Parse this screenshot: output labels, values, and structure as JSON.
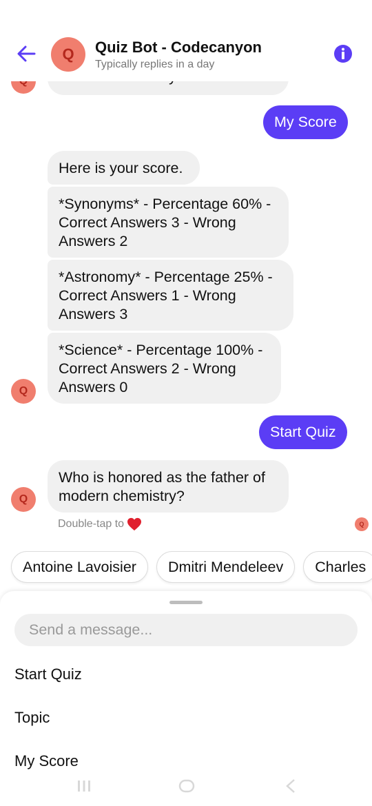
{
  "header": {
    "avatar_letter": "Q",
    "title": "Quiz Bot - Codecanyon",
    "subtitle": "Typically replies in a day"
  },
  "messages": {
    "top_partial": "modern chemistry?",
    "user_score": "My Score",
    "bot_intro": "Here is your score.",
    "score_synonyms": "*Synonyms* - Percentage 60% - Correct Answers 3 - Wrong Answers 2",
    "score_astronomy": "*Astronomy* - Percentage 25% - Correct Answers 1 - Wrong Answers 3",
    "score_science": "*Science* - Percentage 100% - Correct Answers 2 - Wrong Answers 0",
    "user_start": "Start Quiz",
    "bot_question": "Who is honored as the father of modern chemistry?",
    "avatar_letter": "Q"
  },
  "hint": {
    "text": "Double-tap to",
    "icon": "heart-icon"
  },
  "quick_replies": [
    "Antoine Lavoisier",
    "Dmitri Mendeleev",
    "Charles"
  ],
  "composer": {
    "placeholder": "Send a message..."
  },
  "menu": {
    "items": [
      "Start Quiz",
      "Topic",
      "My Score"
    ]
  },
  "colors": {
    "accent": "#5b3df5",
    "avatar": "#f07e6e",
    "bubble": "#f0f0f0"
  }
}
